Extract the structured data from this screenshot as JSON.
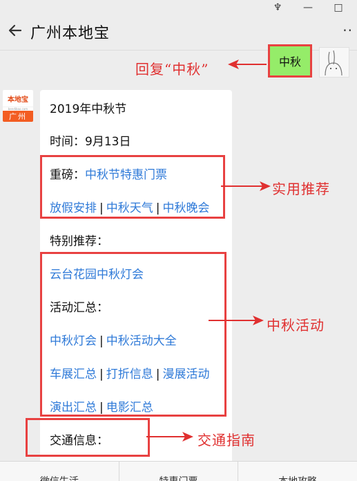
{
  "window": {
    "controls": {
      "pin": "♆",
      "minimize": "—",
      "maximize": "□"
    }
  },
  "header": {
    "title": "广州本地宝",
    "back_icon": "back-arrow-icon",
    "more_icon": "more-dots-icon",
    "more": "··"
  },
  "outgoing": {
    "text": "中秋",
    "bubble_color": "#95ec69"
  },
  "bot_avatar": {
    "brand": "本地宝",
    "url": "bendibao.com",
    "city": "广州"
  },
  "message": {
    "line1": "2019年中秋节",
    "line2": "时间：9月13日",
    "featured_label": "重磅：",
    "featured_link": "中秋节特惠门票",
    "links_row1": [
      "放假安排",
      "中秋天气",
      "中秋晚会"
    ],
    "special_label": "特别推荐：",
    "special_link": "云台花园中秋灯会",
    "activity_label": "活动汇总：",
    "activity_links_row1": [
      "中秋灯会",
      "中秋活动大全"
    ],
    "activity_links_row2": [
      "车展汇总",
      "打折信息",
      "漫展活动"
    ],
    "activity_links_row3": [
      "演出汇总",
      "电影汇总"
    ],
    "traffic_label": "交通信息：",
    "separator": "|",
    "link_color": "#2f7ad8"
  },
  "annotations": {
    "reply": "回复“中秋”",
    "practical": "实用推荐",
    "activities": "中秋活动",
    "traffic": "交通指南",
    "color": "#e03030"
  },
  "bottom_menu": {
    "items": [
      "微信生活",
      "特惠门票",
      "本地攻略"
    ]
  }
}
